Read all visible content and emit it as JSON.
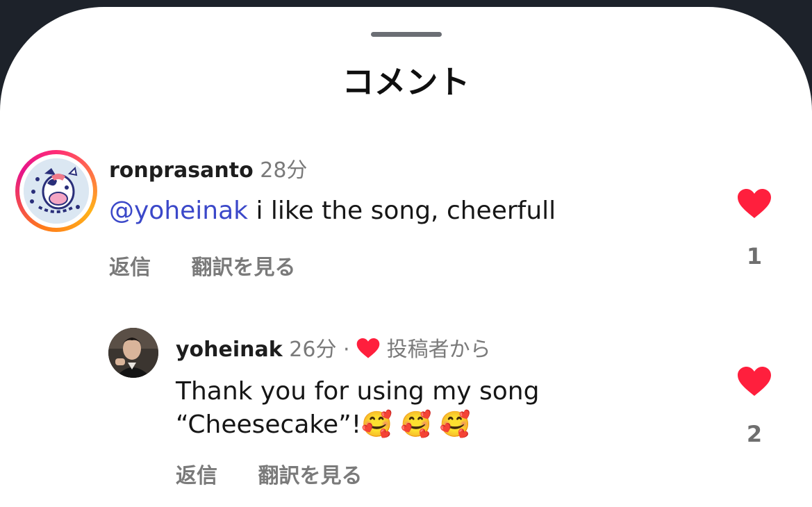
{
  "sheet": {
    "title": "コメント"
  },
  "comments": [
    {
      "username": "ronprasanto",
      "time": "28分",
      "mention": "@yoheinak",
      "text": " i like the song, cheerfull",
      "reply_label": "返信",
      "translate_label": "翻訳を見る",
      "like_count": "1"
    },
    {
      "username": "yoheinak",
      "time": "26分",
      "separator": "·",
      "liked_by_author": "投稿者から",
      "text_line1": "Thank you for using my song",
      "text_line2": "“Cheesecake”!",
      "emojis": "🥰 🥰 🥰",
      "reply_label": "返信",
      "translate_label": "翻訳を見る",
      "like_count": "2"
    }
  ],
  "colors": {
    "heart": "#ff1f3d",
    "mention": "#3b48c9",
    "secondary_text": "#7a7a7a"
  }
}
